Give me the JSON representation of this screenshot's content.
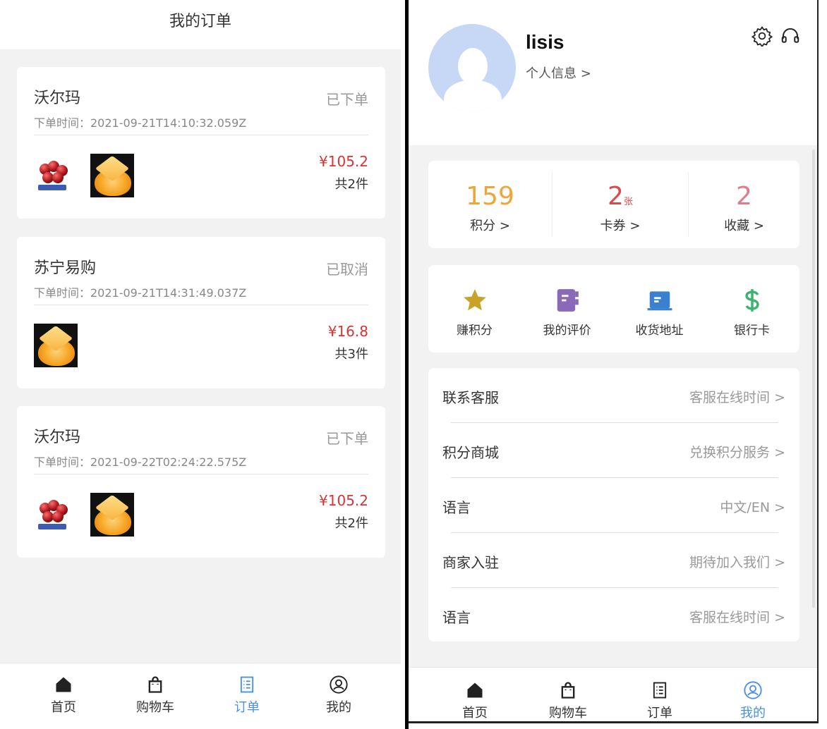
{
  "orders_page": {
    "title": "我的订单",
    "orders": [
      {
        "shop": "沃尔玛",
        "status": "已下单",
        "time": "下单时间：2021-09-21T14:10:32.059Z",
        "price": "¥105.2",
        "count": "共2件",
        "products": [
          "cherry",
          "orange"
        ]
      },
      {
        "shop": "苏宁易购",
        "status": "已取消",
        "time": "下单时间：2021-09-21T14:31:49.037Z",
        "price": "¥16.8",
        "count": "共3件",
        "products": [
          "orange"
        ]
      },
      {
        "shop": "沃尔玛",
        "status": "已下单",
        "time": "下单时间：2021-09-22T02:24:22.575Z",
        "price": "¥105.2",
        "count": "共2件",
        "products": [
          "cherry",
          "orange"
        ]
      }
    ],
    "tabbar": [
      {
        "label": "首页",
        "icon": "home-icon"
      },
      {
        "label": "购物车",
        "icon": "shopping-bag-icon"
      },
      {
        "label": "订单",
        "icon": "order-list-icon",
        "active": true
      },
      {
        "label": "我的",
        "icon": "user-circle-icon"
      }
    ]
  },
  "profile_page": {
    "username": "lisis",
    "profile_link": "个人信息 >",
    "header_icons": [
      "gear-icon",
      "headset-icon"
    ],
    "stats": [
      {
        "value": "159",
        "label": "积分 >",
        "color": "#f0a43a"
      },
      {
        "value": "2",
        "unit": "张",
        "label": "卡券 >",
        "color": "#d94a4a"
      },
      {
        "value": "2",
        "label": "收藏 >",
        "color": "#e07c8a"
      }
    ],
    "shortcuts": [
      {
        "label": "赚积分",
        "icon": "star-icon",
        "color": "#c9a227"
      },
      {
        "label": "我的评价",
        "icon": "notebook-icon",
        "color": "#8a6ab8"
      },
      {
        "label": "收货地址",
        "icon": "address-card-icon",
        "color": "#3a7fd0"
      },
      {
        "label": "银行卡",
        "icon": "dollar-icon",
        "color": "#3cb371"
      }
    ],
    "menu": [
      {
        "label": "联系客服",
        "value": "客服在线时间 >"
      },
      {
        "label": "积分商城",
        "value": "兑换积分服务 >"
      },
      {
        "label": "语言",
        "value": "中文/EN >"
      },
      {
        "label": "商家入驻",
        "value": "期待加入我们 >"
      },
      {
        "label": "语言",
        "value": "客服在线时间 >"
      }
    ],
    "tabbar": [
      {
        "label": "首页",
        "icon": "home-icon"
      },
      {
        "label": "购物车",
        "icon": "shopping-bag-icon"
      },
      {
        "label": "订单",
        "icon": "order-list-icon"
      },
      {
        "label": "我的",
        "icon": "user-circle-icon",
        "active": true
      }
    ]
  },
  "colors": {
    "accent": "#4a90e2",
    "price": "#d93434",
    "background": "#f2f2f2"
  }
}
